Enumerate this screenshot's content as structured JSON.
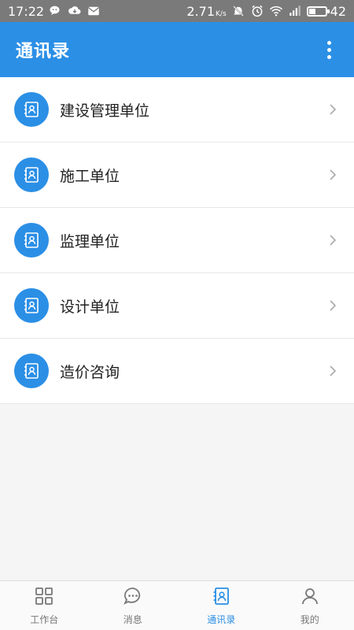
{
  "status_bar": {
    "time": "17:22",
    "speed": "2.71",
    "speed_unit": "K/s",
    "battery": "42",
    "battery_level": 0.42
  },
  "header": {
    "title": "通讯录"
  },
  "list": {
    "items": [
      {
        "label": "建设管理单位"
      },
      {
        "label": "施工单位"
      },
      {
        "label": "监理单位"
      },
      {
        "label": "设计单位"
      },
      {
        "label": "造价咨询"
      }
    ]
  },
  "bottom_nav": {
    "items": [
      {
        "label": "工作台",
        "icon": "grid-icon"
      },
      {
        "label": "消息",
        "icon": "chat-icon"
      },
      {
        "label": "通讯录",
        "icon": "contacts-icon"
      },
      {
        "label": "我的",
        "icon": "person-icon"
      }
    ],
    "active_index": 2
  },
  "colors": {
    "accent": "#2b8fe6",
    "status_bar": "#7a7a7a",
    "inactive": "#777777"
  }
}
